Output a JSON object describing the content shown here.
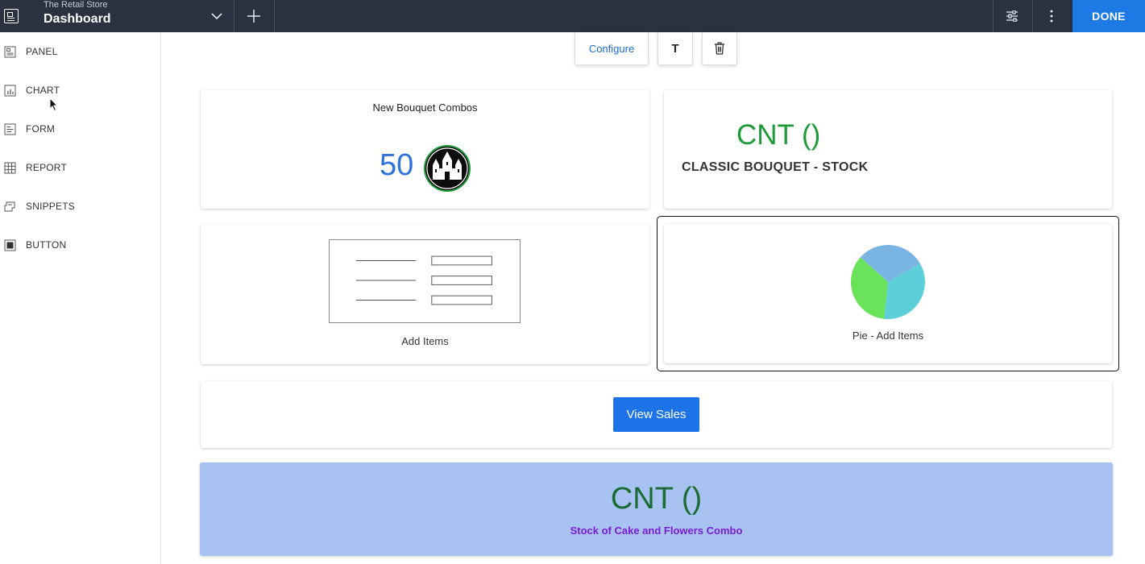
{
  "header": {
    "app_name": "The Retail Store",
    "page_title": "Dashboard",
    "done_label": "DONE"
  },
  "sidebar": {
    "items": [
      {
        "label": "PANEL",
        "icon": "panel-icon"
      },
      {
        "label": "CHART",
        "icon": "chart-icon"
      },
      {
        "label": "FORM",
        "icon": "form-icon"
      },
      {
        "label": "REPORT",
        "icon": "report-icon"
      },
      {
        "label": "SNIPPETS",
        "icon": "snippets-icon"
      },
      {
        "label": "BUTTON",
        "icon": "button-icon"
      }
    ]
  },
  "toolbar": {
    "configure_label": "Configure",
    "text_label": "T"
  },
  "cards": {
    "combos": {
      "title": "New Bouquet Combos",
      "value": "50"
    },
    "classic": {
      "value": "CNT ()",
      "label": "CLASSIC BOUQUET - STOCK"
    },
    "form": {
      "label": "Add Items"
    },
    "pie": {
      "label": "Pie - Add Items",
      "slices": [
        {
          "value": 35,
          "color": "#5ccfd8"
        },
        {
          "value": 35,
          "color": "#6ae35a"
        },
        {
          "value": 30,
          "color": "#7ab4e3"
        }
      ]
    },
    "button": {
      "label": "View Sales"
    },
    "stock": {
      "value": "CNT ()",
      "label": "Stock of Cake and Flowers Combo"
    }
  },
  "colors": {
    "topbar": "#2b3141",
    "accent": "#1d7ae5",
    "stock_banner": "#a8c3f2"
  }
}
